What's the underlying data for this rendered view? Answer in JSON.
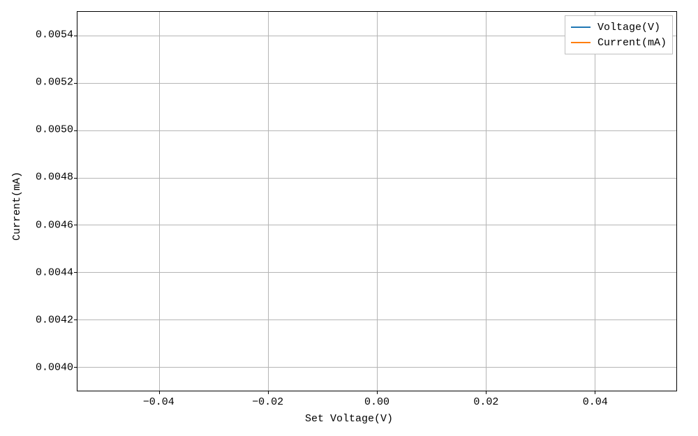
{
  "chart_data": {
    "type": "line",
    "title": "",
    "xlabel": "Set Voltage(V)",
    "ylabel": "Current(mA)",
    "x_ticks": [
      -0.04,
      -0.02,
      0.0,
      0.02,
      0.04
    ],
    "x_tick_labels": [
      "−0.04",
      "−0.02",
      "0.00",
      "0.02",
      "0.04"
    ],
    "y_ticks": [
      0.004,
      0.0042,
      0.0044,
      0.0046,
      0.0048,
      0.005,
      0.0052,
      0.0054
    ],
    "y_tick_labels": [
      "0.0040",
      "0.0042",
      "0.0044",
      "0.0046",
      "0.0048",
      "0.0050",
      "0.0052",
      "0.0054"
    ],
    "xlim": [
      -0.055,
      0.055
    ],
    "ylim": [
      0.0039,
      0.0055
    ],
    "grid": true,
    "series": [
      {
        "name": "Voltage(V)",
        "color": "#1f77b4",
        "values": []
      },
      {
        "name": "Current(mA)",
        "color": "#ff7f0e",
        "values": []
      }
    ],
    "categories": []
  },
  "legend": {
    "items": [
      {
        "label": "Voltage(V)",
        "color": "#1f77b4"
      },
      {
        "label": "Current(mA)",
        "color": "#ff7f0e"
      }
    ]
  },
  "axes": {
    "xlabel": "Set Voltage(V)",
    "ylabel": "Current(mA)"
  }
}
